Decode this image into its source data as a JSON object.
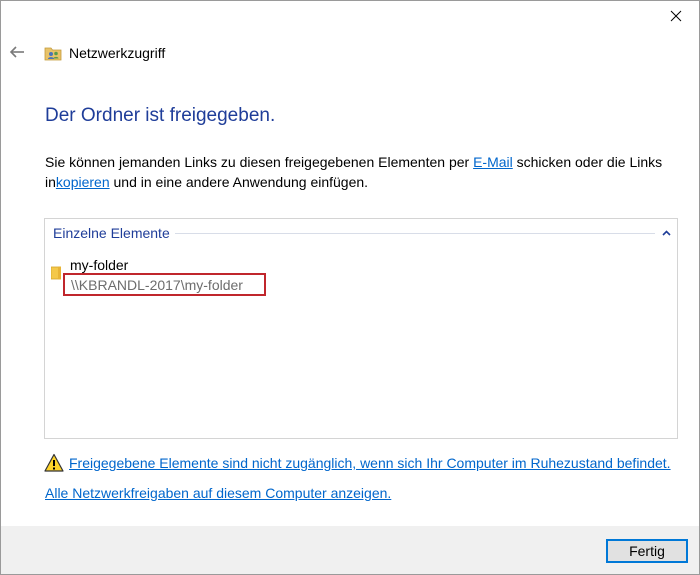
{
  "window": {
    "title": "Netzwerkzugriff"
  },
  "heading": "Der Ordner ist freigegeben.",
  "description": {
    "part1": "Sie können jemanden Links zu diesen freigegebenen Elementen per ",
    "email_link": "E-Mail",
    "part2": " schicken oder die Links in",
    "copy_link": "kopieren",
    "part3": " und in eine andere Anwendung einfügen."
  },
  "items_panel": {
    "group_label": "Einzelne Elemente",
    "items": [
      {
        "name": "my-folder",
        "path": "\\\\KBRANDL-2017\\my-folder"
      }
    ]
  },
  "warning_link": "Freigegebene Elemente sind nicht zugänglich, wenn sich Ihr Computer im Ruhezustand befindet.",
  "share_link": "Alle Netzwerkfreigaben auf diesem Computer anzeigen.",
  "footer": {
    "finish_label": "Fertig"
  },
  "colors": {
    "heading": "#1f3d99",
    "link": "#0066cc",
    "highlight_border": "#c0262c",
    "footer_bg": "#f0f0f0",
    "button_border": "#0078d7"
  },
  "icons": {
    "close": "close-icon",
    "back": "back-arrow-icon",
    "app": "network-share-icon",
    "chevron": "chevron-up-icon",
    "folder": "folder-icon",
    "warning": "warning-icon"
  }
}
